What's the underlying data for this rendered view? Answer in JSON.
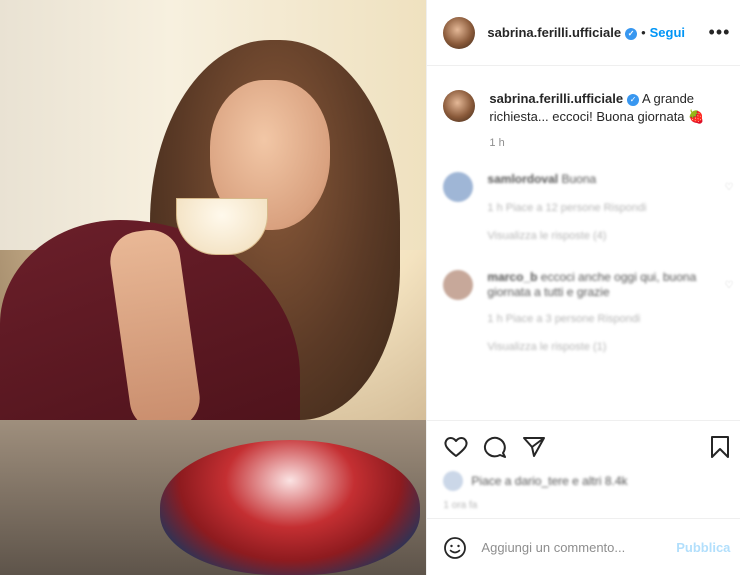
{
  "post": {
    "image_alt": "",
    "username": "sabrina.ferilli.ufficiale",
    "follow_label": "Segui",
    "more_label": "•••",
    "caption_text": "A grande richiesta... eccoci! Buona giornata",
    "caption_emoji": "🍓",
    "time_ago": "1 h",
    "add_comment_placeholder": "Aggiungi un commento...",
    "publish_label": "Pubblica"
  },
  "comments": [
    {
      "user": "samlordoval",
      "text": "Buona",
      "meta": "1 h  Piace a 12 persone  Rispondi",
      "replies": "Visualizza le risposte (4)"
    },
    {
      "user": "marco_b",
      "text": "eccoci anche oggi qui, buona giornata a tutti e grazie",
      "meta": "1 h  Piace a 3 persone  Rispondi",
      "replies": "Visualizza le risposte (1)"
    }
  ],
  "likes_text": "Piace a dario_tere e altri 8.4k",
  "icons": [
    "heart-icon",
    "comment-icon",
    "share-icon",
    "bookmark-icon",
    "smiley-icon",
    "verified-icon",
    "more-icon"
  ],
  "colors": {
    "accent": "#0095f6",
    "verified": "#3897f0",
    "publish_disabled": "#b2dffc",
    "muted": "#8e8e8e",
    "text": "#262626"
  }
}
